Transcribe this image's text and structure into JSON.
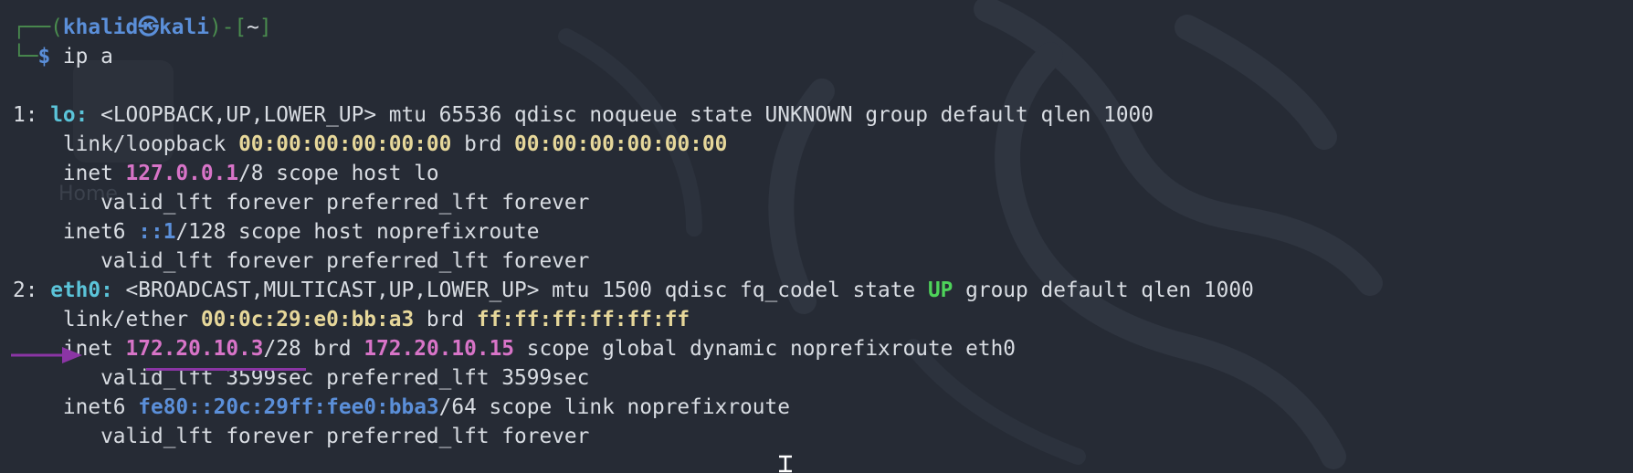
{
  "prompt": {
    "frame_open": "┌──(",
    "user": "khalid",
    "at": "㉿",
    "host": "kali",
    "frame_close": ")-[",
    "cwd": "~",
    "frame_end": "]",
    "frame_lower": "└─",
    "dollar": "$",
    "command": " ip a"
  },
  "desktop": {
    "ghost_label": "Home"
  },
  "lines": {
    "l1_num": "1: ",
    "l1_iface": "lo:",
    "l1_rest": " <LOOPBACK,UP,LOWER_UP> mtu 65536 qdisc noqueue state UNKNOWN group default qlen 1000",
    "l2_a": "    link/loopback ",
    "l2_mac": "00:00:00:00:00:00",
    "l2_b": " brd ",
    "l2_brd": "00:00:00:00:00:00",
    "l3_a": "    inet ",
    "l3_ip": "127.0.0.1",
    "l3_b": "/8 scope host lo",
    "l4": "       valid_lft forever preferred_lft forever",
    "l5_a": "    inet6 ",
    "l5_ip": "::1",
    "l5_b": "/128 scope host noprefixroute",
    "l6": "       valid_lft forever preferred_lft forever",
    "l7_num": "2: ",
    "l7_iface": "eth0:",
    "l7_a": " <BROADCAST,MULTICAST,UP,LOWER_UP> mtu 1500 qdisc fq_codel state ",
    "l7_state": "UP",
    "l7_b": " group default qlen 1000",
    "l8_a": "    link/ether ",
    "l8_mac": "00:0c:29:e0:bb:a3",
    "l8_b": " brd ",
    "l8_brd": "ff:ff:ff:ff:ff:ff",
    "l9_a": "    inet ",
    "l9_ip": "172.20.10.3",
    "l9_b": "/28 brd ",
    "l9_brd": "172.20.10.15",
    "l9_c": " scope global dynamic noprefixroute eth0",
    "l10": "       valid_lft 3599sec preferred_lft 3599sec",
    "l11_a": "    inet6 ",
    "l11_ip": "fe80::20c:29ff:fee0:bba3",
    "l11_b": "/64 scope link noprefixroute",
    "l12": "       valid_lft forever preferred_lft forever"
  },
  "colors": {
    "background": "#262b35",
    "annotation": "#8b35a5",
    "ipv4": "#d874c8",
    "interface": "#5bc4d9",
    "mac": "#e6d79a",
    "state_up": "#4ed35a"
  }
}
